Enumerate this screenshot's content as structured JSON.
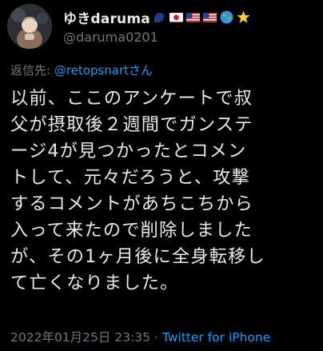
{
  "user": {
    "display_name": "ゆきdaruma",
    "badge_emojis": [
      "speaking-head-emoji",
      "japan-flag-emoji",
      "us-flag-emoji",
      "us-flag-emoji",
      "globe-emoji",
      "glowing-star-emoji"
    ],
    "handle": "@daruma0201"
  },
  "reply": {
    "prefix": "返信先: ",
    "target": "@retopsnartさん"
  },
  "tweet": {
    "lines": [
      "以前、ここのアンケートで叔",
      "父が摂取後２週間でガンステ",
      "ージ4が見つかったとコメン",
      "トして、元々だろうと、攻撃",
      "するコメントがあちこちから",
      "入って来たので削除しました",
      "が、その1ヶ月後に全身転移し",
      "て亡くなりました。"
    ]
  },
  "meta": {
    "date": "2022年01月25日",
    "time": "23:35",
    "separator": "·",
    "source": "Twitter for iPhone"
  },
  "colors": {
    "background": "#000000",
    "text": "#e7e9ea",
    "secondary": "#71767b",
    "link": "#1d9bf0"
  }
}
